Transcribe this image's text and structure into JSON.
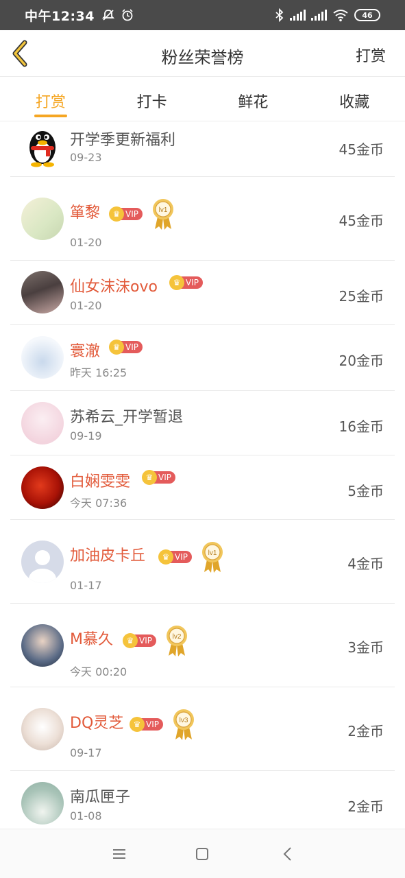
{
  "status": {
    "time": "中午12:34",
    "battery": "46"
  },
  "nav": {
    "title": "粉丝荣誉榜",
    "action": "打赏"
  },
  "tabs": [
    "打赏",
    "打卡",
    "鲜花",
    "收藏"
  ],
  "rows": [
    {
      "name": "开学季更新福利",
      "date": "09-23",
      "amount": "45金币"
    },
    {
      "name": "箪黎",
      "vip": "VIP",
      "level": "lv1",
      "date": "01-20",
      "amount": "45金币"
    },
    {
      "name": "仙女沫沫ovo",
      "vip": "VIP",
      "date": "01-20",
      "amount": "25金币"
    },
    {
      "name": "寰澈",
      "vip": "VIP",
      "date": "昨天 16:25",
      "amount": "20金币"
    },
    {
      "name": "苏希云_开学暂退",
      "date": "09-19",
      "amount": "16金币"
    },
    {
      "name": "白娴雯雯",
      "vip": "VIP",
      "date": "今天 07:36",
      "amount": "5金币"
    },
    {
      "name": "加油皮卡丘",
      "vip": "VIP",
      "level": "lv1",
      "date": "01-17",
      "amount": "4金币"
    },
    {
      "name": "M慕久",
      "vip": "VIP",
      "level": "lv2",
      "date": "今天 00:20",
      "amount": "3金币"
    },
    {
      "name": "DQ灵芝",
      "vip": "VIP",
      "level": "lv3",
      "date": "09-17",
      "amount": "2金币"
    },
    {
      "name": "南瓜匣子",
      "date": "01-08",
      "amount": "2金币"
    }
  ],
  "colors": {
    "accent": "#f5a623",
    "vip_name": "#e25a3a",
    "vip_tag": "#e45b5b"
  }
}
